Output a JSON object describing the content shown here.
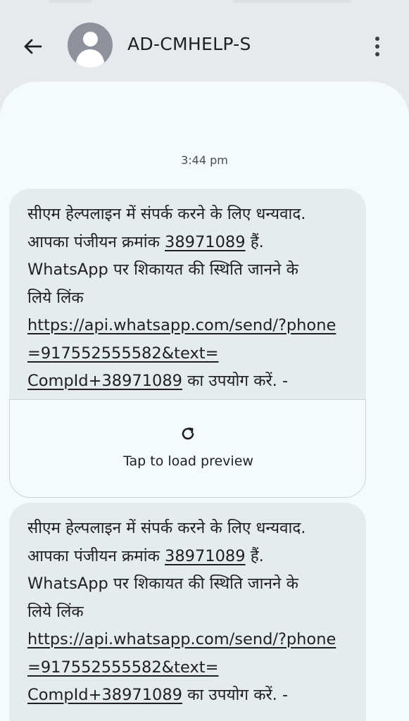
{
  "header": {
    "back_icon": "arrow-back-icon",
    "avatar_icon": "person-icon",
    "contact_name": "AD-CMHELP-S",
    "more_icon": "more-vert-icon"
  },
  "conversation": {
    "timestamp": "3:44 pm",
    "messages": [
      {
        "line1": "सीएम हेल्पलाइन में संपर्क करने के लिए धन्यवाद.",
        "line2_prefix": "आपका पंजीयन क्रमांक ",
        "reg_number": "38971089",
        "line2_suffix": " हैं.",
        "line3": "WhatsApp पर शिकायत की स्थिति जानने के",
        "line4": "लिये लिंक",
        "link_line1": "https://api.whatsapp.com/send/?phone",
        "link_line2": "=917552555582&text=",
        "link_line3": "CompId+38971089",
        "line_end": " का उपयोग करें. -"
      },
      {
        "line1": "सीएम हेल्पलाइन में संपर्क करने के लिए धन्यवाद.",
        "line2_prefix": "आपका पंजीयन क्रमांक ",
        "reg_number": "38971089",
        "line2_suffix": " हैं.",
        "line3": "WhatsApp पर शिकायत की स्थिति जानने के",
        "line4": "लिये लिंक",
        "link_line1": "https://api.whatsapp.com/send/?phone",
        "link_line2": "=917552555582&text=",
        "link_line3": "CompId+38971089",
        "line_end": " का उपयोग करें. -"
      }
    ],
    "preview": {
      "icon": "reload-icon",
      "label": "Tap to load preview"
    }
  },
  "colors": {
    "background": "#e6eaee",
    "panel": "#f3fbfd",
    "bubble": "#e5ecef",
    "avatar": "#8e929c"
  }
}
